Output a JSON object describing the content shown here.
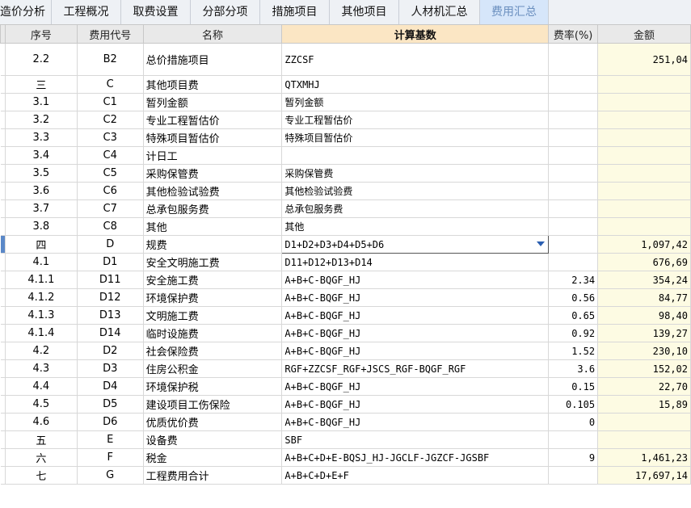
{
  "tabs": [
    {
      "label": "造价分析"
    },
    {
      "label": "工程概况"
    },
    {
      "label": "取费设置"
    },
    {
      "label": "分部分项"
    },
    {
      "label": "措施项目"
    },
    {
      "label": "其他项目"
    },
    {
      "label": "人材机汇总"
    },
    {
      "label": "费用汇总"
    }
  ],
  "active_tab": "费用汇总",
  "columns": {
    "seq": "序号",
    "code": "费用代号",
    "name": "名称",
    "calc": "计算基数",
    "rate": "费率(%)",
    "amount": "金额"
  },
  "rows": [
    {
      "seq": "2.2",
      "code": "B2",
      "name": "总价措施项目",
      "calc": "ZZCSF",
      "rate": "",
      "amount": "251,04"
    },
    {
      "seq": "三",
      "code": "C",
      "name": "其他项目费",
      "calc": "QTXMHJ",
      "rate": "",
      "amount": ""
    },
    {
      "seq": "3.1",
      "code": "C1",
      "name": "暂列金额",
      "calc": "暂列金额",
      "rate": "",
      "amount": ""
    },
    {
      "seq": "3.2",
      "code": "C2",
      "name": "专业工程暂估价",
      "calc": "专业工程暂估价",
      "rate": "",
      "amount": ""
    },
    {
      "seq": "3.3",
      "code": "C3",
      "name": "特殊项目暂估价",
      "calc": "特殊项目暂估价",
      "rate": "",
      "amount": ""
    },
    {
      "seq": "3.4",
      "code": "C4",
      "name": "计日工",
      "calc": "",
      "rate": "",
      "amount": ""
    },
    {
      "seq": "3.5",
      "code": "C5",
      "name": "采购保管费",
      "calc": "采购保管费",
      "rate": "",
      "amount": ""
    },
    {
      "seq": "3.6",
      "code": "C6",
      "name": "其他检验试验费",
      "calc": "其他检验试验费",
      "rate": "",
      "amount": ""
    },
    {
      "seq": "3.7",
      "code": "C7",
      "name": "总承包服务费",
      "calc": "总承包服务费",
      "rate": "",
      "amount": ""
    },
    {
      "seq": "3.8",
      "code": "C8",
      "name": "其他",
      "calc": "其他",
      "rate": "",
      "amount": ""
    },
    {
      "seq": "四",
      "code": "D",
      "name": "规费",
      "calc": "D1+D2+D3+D4+D5+D6",
      "rate": "",
      "amount": "1,097,42"
    },
    {
      "seq": "4.1",
      "code": "D1",
      "name": "安全文明施工费",
      "calc": "D11+D12+D13+D14",
      "rate": "",
      "amount": "676,69"
    },
    {
      "seq": "4.1.1",
      "code": "D11",
      "name": "安全施工费",
      "calc": "A+B+C-BQGF_HJ",
      "rate": "2.34",
      "amount": "354,24"
    },
    {
      "seq": "4.1.2",
      "code": "D12",
      "name": "环境保护费",
      "calc": "A+B+C-BQGF_HJ",
      "rate": "0.56",
      "amount": "84,77"
    },
    {
      "seq": "4.1.3",
      "code": "D13",
      "name": "文明施工费",
      "calc": "A+B+C-BQGF_HJ",
      "rate": "0.65",
      "amount": "98,40"
    },
    {
      "seq": "4.1.4",
      "code": "D14",
      "name": "临时设施费",
      "calc": "A+B+C-BQGF_HJ",
      "rate": "0.92",
      "amount": "139,27"
    },
    {
      "seq": "4.2",
      "code": "D2",
      "name": "社会保险费",
      "calc": "A+B+C-BQGF_HJ",
      "rate": "1.52",
      "amount": "230,10"
    },
    {
      "seq": "4.3",
      "code": "D3",
      "name": "住房公积金",
      "calc": "RGF+ZZCSF_RGF+JSCS_RGF-BQGF_RGF",
      "rate": "3.6",
      "amount": "152,02"
    },
    {
      "seq": "4.4",
      "code": "D4",
      "name": "环境保护税",
      "calc": "A+B+C-BQGF_HJ",
      "rate": "0.15",
      "amount": "22,70"
    },
    {
      "seq": "4.5",
      "code": "D5",
      "name": "建设项目工伤保险",
      "calc": "A+B+C-BQGF_HJ",
      "rate": "0.105",
      "amount": "15,89"
    },
    {
      "seq": "4.6",
      "code": "D6",
      "name": "优质优价费",
      "calc": "A+B+C-BQGF_HJ",
      "rate": "0",
      "amount": ""
    },
    {
      "seq": "五",
      "code": "E",
      "name": "设备费",
      "calc": "SBF",
      "rate": "",
      "amount": ""
    },
    {
      "seq": "六",
      "code": "F",
      "name": "税金",
      "calc": "A+B+C+D+E-BQSJ_HJ-JGCLF-JGZCF-JGSBF",
      "rate": "9",
      "amount": "1,461,23"
    },
    {
      "seq": "七",
      "code": "G",
      "name": "工程费用合计",
      "calc": "A+B+C+D+E+F",
      "rate": "",
      "amount": "17,697,14"
    }
  ],
  "selected_row": "四",
  "editing_cell": "calc"
}
